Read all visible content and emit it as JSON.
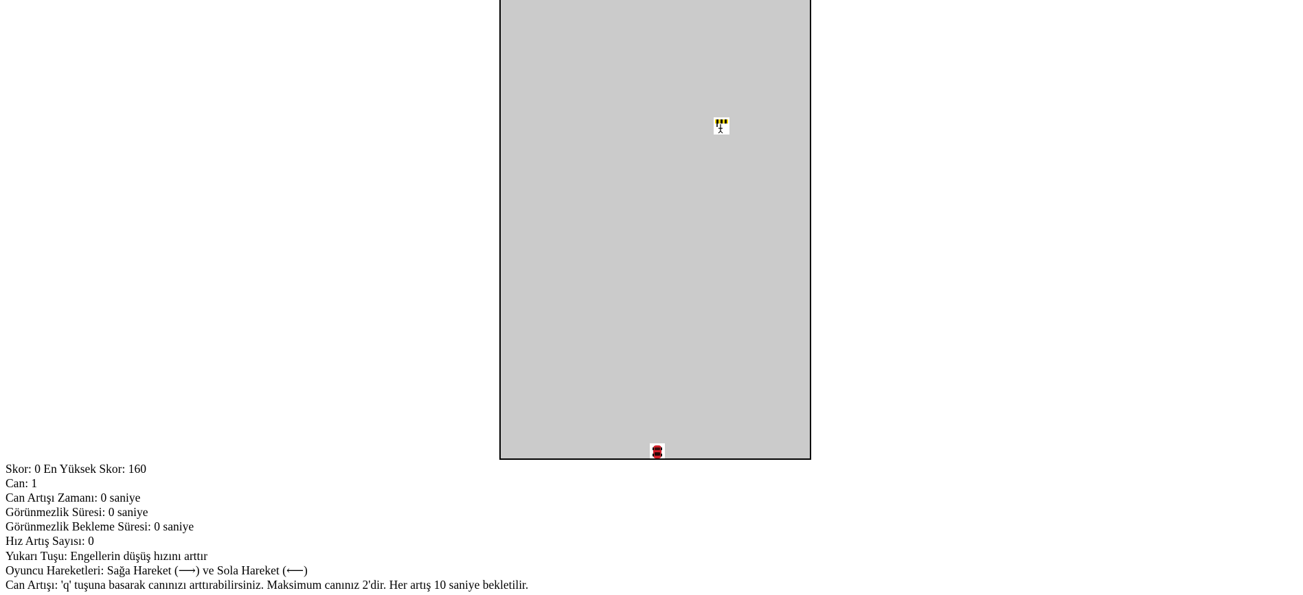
{
  "game": {
    "obstacle_icon": "road-barrier-icon",
    "player_icon": "red-car-icon",
    "colors": {
      "board_background": "#cbcbcb",
      "board_border": "#000000",
      "car": "#d01f2a",
      "barrier_stripe": "#f2d400"
    }
  },
  "info": {
    "score_line": "Skor: 0 En Yüksek Skor: 160",
    "lives_line": "Can: 1",
    "life_boost_time_line": "Can Artışı Zamanı: 0 saniye",
    "invisibility_duration_line": "Görünmezlik Süresi: 0 saniye",
    "invisibility_cooldown_line": "Görünmezlik Bekleme Süresi: 0 saniye",
    "speed_boost_count_line": "Hız Artış Sayısı: 0",
    "up_key_help": "Yukarı Tuşu: Engellerin düşüş hızını arttır",
    "movement_help": "Oyuncu Hareketleri: Sağa Hareket (⟶) ve Sola Hareket (⟵)",
    "life_boost_help": "Can Artışı: 'q' tuşuna basarak canınızı arttırabilirsiniz. Maksimum canınız 2'dir. Her artış 10 saniye bekletilir."
  }
}
